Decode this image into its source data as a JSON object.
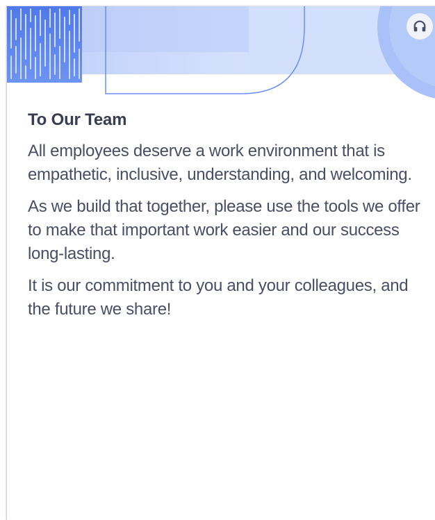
{
  "banner": {
    "support_icon": "headset-icon"
  },
  "letter": {
    "heading": "To Our Team",
    "paragraphs": [
      "All employees deserve a work environment that is empathetic, inclusive, understanding, and welcoming.",
      "As we build that together, please use the tools we offer to make that important work easier and our success long-lasting.",
      "It is our commitment to you and your colleagues, and the future we share!"
    ]
  },
  "colors": {
    "accent": "#5b84ee",
    "banner_light": "#dbe5fc",
    "text": "#4a4d66"
  }
}
